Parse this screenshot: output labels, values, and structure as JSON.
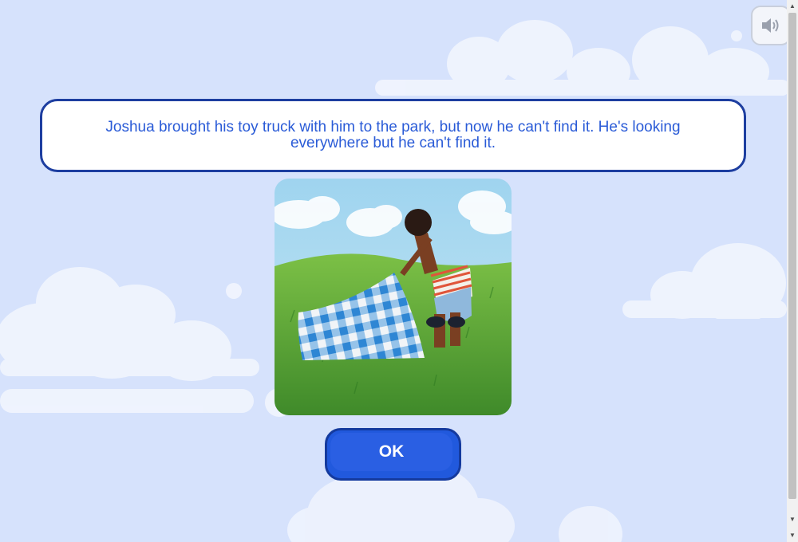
{
  "story": {
    "text": "Joshua brought his toy truck with him to the park, but now he can't find it. He's looking everywhere but he can't find it."
  },
  "buttons": {
    "ok_label": "OK",
    "sound_icon": "speaker-icon"
  },
  "illustration": {
    "subject": "Child lifting a blue gingham picnic blanket on a grassy hill"
  },
  "scrollbar": {
    "up_glyph": "▲",
    "down_glyph": "▼"
  },
  "colors": {
    "background": "#d6e2fc",
    "accent": "#2a5bd7",
    "border": "#1d3ea0",
    "button": "#2159dd"
  }
}
